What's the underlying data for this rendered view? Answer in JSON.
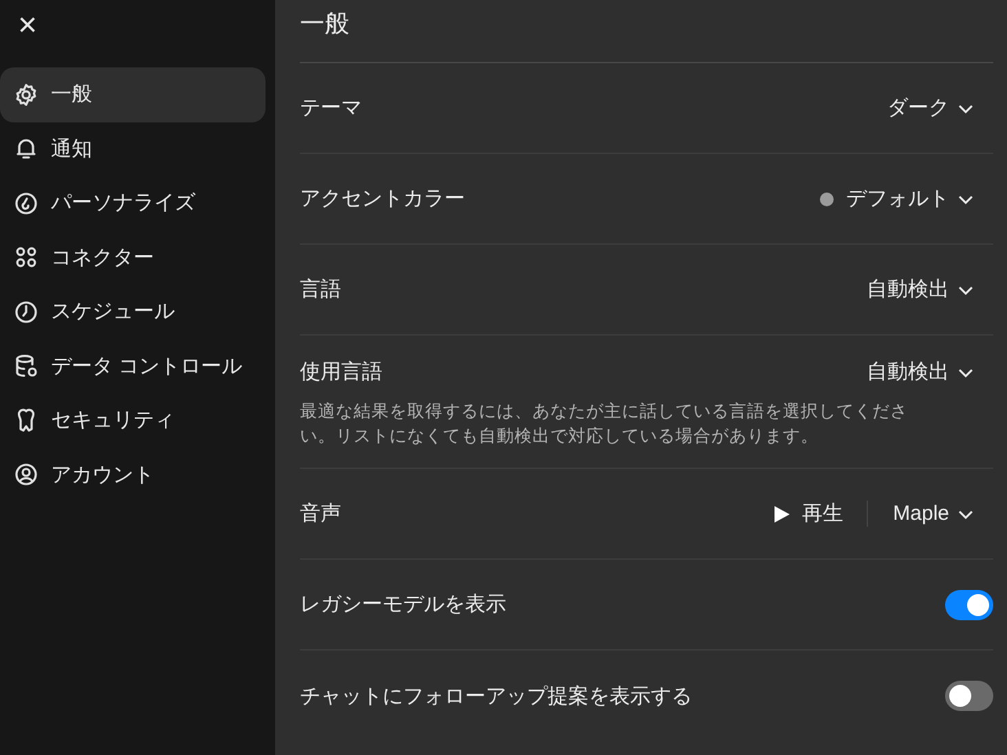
{
  "sidebar": {
    "close": "×",
    "items": [
      {
        "label": "一般",
        "selected": true
      },
      {
        "label": "通知",
        "selected": false
      },
      {
        "label": "パーソナライズ",
        "selected": false
      },
      {
        "label": "コネクター",
        "selected": false
      },
      {
        "label": "スケジュール",
        "selected": false
      },
      {
        "label": "データ コントロール",
        "selected": false
      },
      {
        "label": "セキュリティ",
        "selected": false
      },
      {
        "label": "アカウント",
        "selected": false
      }
    ]
  },
  "panel": {
    "title": "一般",
    "rows": [
      {
        "kind": "select",
        "label": "テーマ",
        "value": "ダーク"
      },
      {
        "kind": "select",
        "label": "アクセントカラー",
        "value": "デフォルト",
        "color": "#9b9b9b"
      },
      {
        "kind": "select",
        "label": "言語",
        "value": "自動検出"
      },
      {
        "kind": "select",
        "label": "使用言語",
        "value": "自動検出",
        "description": "最適な結果を取得するには、あなたが主に話している言語を選択してください。リストになくても自動検出で対応している場合があります。"
      },
      {
        "kind": "voice",
        "label": "音声",
        "play": "再生",
        "value": "Maple"
      },
      {
        "kind": "toggle",
        "label": "レガシーモデルを表示",
        "on": true
      },
      {
        "kind": "toggle",
        "label": "チャットにフォローアップ提案を表示する",
        "on": false
      }
    ]
  }
}
